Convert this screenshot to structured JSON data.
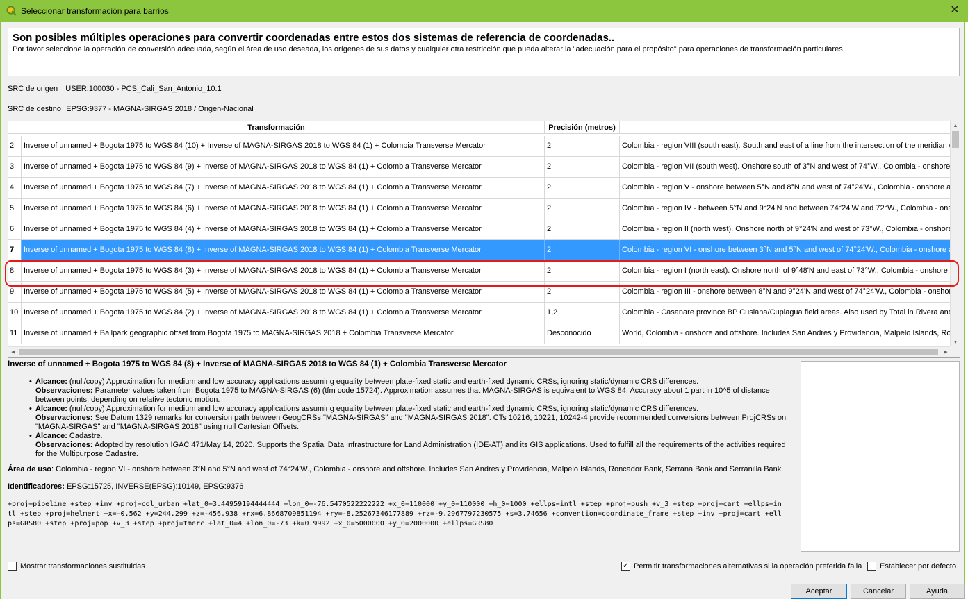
{
  "window": {
    "title": "Seleccionar transformación para barrios",
    "close_glyph": "✕"
  },
  "info": {
    "heading": "Son posibles múltiples operaciones para convertir coordenadas entre estos dos sistemas de referencia de coordenadas..",
    "subtext": "Por favor seleccione la operación de conversión adecuada, según el área de uso deseada, los orígenes de sus datos y cualquier otra restricción que pueda alterar la \"adecuación para el propósito\" para operaciones de transformación particulares"
  },
  "source": {
    "label": "SRC de origen",
    "value": "USER:100030 - PCS_Cali_San_Antonio_10.1"
  },
  "dest": {
    "label": "SRC de destino",
    "value": "EPSG:9377 - MAGNA-SIRGAS 2018 / Origen-Nacional"
  },
  "table": {
    "headers": {
      "transform": "Transformación",
      "precision": "Precisión (metros)",
      "area": ""
    },
    "rows": [
      {
        "num": "2",
        "transform": "Inverse of unnamed + Bogota 1975 to WGS 84 (10) + Inverse of MAGNA-SIRGAS 2018 to WGS 84 (1) + Colombia Transverse Mercator",
        "precision": "2",
        "area": "Colombia - region VIII (south east). South and east of a line from the intersection of the meridian of"
      },
      {
        "num": "3",
        "transform": "Inverse of unnamed + Bogota 1975 to WGS 84 (9) + Inverse of MAGNA-SIRGAS 2018 to WGS 84 (1) + Colombia Transverse Mercator",
        "precision": "2",
        "area": "Colombia - region VII (south west). Onshore south of 3°N and west of 74°W., Colombia - onshore an"
      },
      {
        "num": "4",
        "transform": "Inverse of unnamed + Bogota 1975 to WGS 84 (7) + Inverse of MAGNA-SIRGAS 2018 to WGS 84 (1) + Colombia Transverse Mercator",
        "precision": "2",
        "area": "Colombia - region V - onshore between 5°N and 8°N and west of 74°24'W., Colombia - onshore and o"
      },
      {
        "num": "5",
        "transform": "Inverse of unnamed + Bogota 1975 to WGS 84 (6) + Inverse of MAGNA-SIRGAS 2018 to WGS 84 (1) + Colombia Transverse Mercator",
        "precision": "2",
        "area": "Colombia - region IV - between 5°N and 9°24'N and between 74°24'W and 72°W., Colombia - onsho"
      },
      {
        "num": "6",
        "transform": "Inverse of unnamed + Bogota 1975 to WGS 84 (4) + Inverse of MAGNA-SIRGAS 2018 to WGS 84 (1) + Colombia Transverse Mercator",
        "precision": "2",
        "area": "Colombia - region II (north west). Onshore north of 9°24'N and west of 73°W., Colombia - onshore a"
      },
      {
        "num": "7",
        "transform": "Inverse of unnamed + Bogota 1975 to WGS 84 (8) + Inverse of MAGNA-SIRGAS 2018 to WGS 84 (1) + Colombia Transverse Mercator",
        "precision": "2",
        "area": "Colombia - region VI - onshore between 3°N and 5°N and west of 74°24'W., Colombia - onshore and o",
        "selected": true
      },
      {
        "num": "8",
        "transform": "Inverse of unnamed + Bogota 1975 to WGS 84 (3) + Inverse of MAGNA-SIRGAS 2018 to WGS 84 (1) + Colombia Transverse Mercator",
        "precision": "2",
        "area": "Colombia - region I (north east). Onshore north of 9°48'N and east of 73°W., Colombia - onshore an"
      },
      {
        "num": "9",
        "transform": "Inverse of unnamed + Bogota 1975 to WGS 84 (5) + Inverse of MAGNA-SIRGAS 2018 to WGS 84 (1) + Colombia Transverse Mercator",
        "precision": "2",
        "area": "Colombia - region III - onshore between 8°N and 9°24'N and west of 74°24'W., Colombia - onshore a"
      },
      {
        "num": "10",
        "transform": "Inverse of unnamed + Bogota 1975 to WGS 84 (2) + Inverse of MAGNA-SIRGAS 2018 to WGS 84 (1) + Colombia Transverse Mercator",
        "precision": "1,2",
        "area": "Colombia - Casanare province BP Cusiana/Cupiagua field areas. Also used by Total in Rivera and G"
      },
      {
        "num": "11",
        "transform": "Inverse of unnamed + Ballpark geographic offset from Bogota 1975 to MAGNA-SIRGAS 2018 + Colombia Transverse Mercator",
        "precision": "Desconocido",
        "area": "World, Colombia - onshore and offshore. Includes San Andres y Providencia, Malpelo Islands, Ronc"
      }
    ]
  },
  "details": {
    "title": "Inverse of unnamed + Bogota 1975 to WGS 84 (8) + Inverse of MAGNA-SIRGAS 2018 to WGS 84 (1) + Colombia Transverse Mercator",
    "alcance_label": "Alcance:",
    "obs_label": "Observaciones:",
    "items": [
      {
        "alcance": "(null/copy) Approximation for medium and low accuracy applications assuming equality between plate-fixed static and earth-fixed dynamic CRSs, ignoring static/dynamic CRS differences.",
        "obs": "Parameter values taken from Bogota 1975 to MAGNA-SIRGAS (6) (tfm code 15724). Approximation assumes that MAGNA-SIRGAS is equivalent to WGS 84. Accuracy about 1 part in 10^5 of distance between points, depending on relative tectonic motion."
      },
      {
        "alcance": "(null/copy) Approximation for medium and low accuracy applications assuming equality between plate-fixed static and earth-fixed dynamic CRSs, ignoring static/dynamic CRS differences.",
        "obs": "See Datum 1329 remarks for conversion path between GeogCRSs \"MAGNA-SIRGAS\" and \"MAGNA-SIRGAS 2018\". CTs 10216, 10221, 10242-4 provide recommended conversions between ProjCRSs on \"MAGNA-SIRGAS\" and \"MAGNA-SIRGAS 2018\" using null Cartesian Offsets."
      },
      {
        "alcance": "Cadastre.",
        "obs": "Adopted by resolution IGAC 471/May 14, 2020. Supports the Spatial Data Infrastructure for Land Administration (IDE-AT) and its GIS applications. Used to fulfill all the requirements of the activities required for the Multipurpose Cadastre."
      }
    ],
    "area_label": "Área de uso",
    "area_value": ": Colombia - region VI - onshore between 3°N and 5°N and west of 74°24'W., Colombia - onshore and offshore. Includes San Andres y Providencia, Malpelo Islands, Roncador Bank, Serrana Bank and Serranilla Bank.",
    "ids_label": "Identificadores:",
    "ids_value": " EPSG:15725, INVERSE(EPSG):10149, EPSG:9376",
    "proj": "+proj=pipeline +step +inv +proj=col_urban +lat_0=3.44959194444444 +lon_0=-76.5470522222222 +x_0=110000 +y_0=110000 +h_0=1000 +ellps=intl +step +proj=push +v_3 +step +proj=cart +ellps=intl +step +proj=helmert +x=-0.562 +y=244.299 +z=-456.938 +rx=6.8668709851194 +ry=-8.25267346177889 +rz=-9.2967797230575 +s=3.74656 +convention=coordinate_frame +step +inv +proj=cart +ellps=GRS80 +step +proj=pop +v_3 +step +proj=tmerc +lat_0=4 +lon_0=-73 +k=0.9992 +x_0=5000000 +y_0=2000000 +ellps=GRS80"
  },
  "options": {
    "show_superseded": {
      "label": "Mostrar transformaciones sustituidas",
      "checked": false
    },
    "allow_fallback": {
      "label": "Permitir transformaciones alternativas si la operación preferida falla",
      "checked": true
    },
    "set_default": {
      "label": "Establecer por defecto",
      "checked": false
    }
  },
  "buttons": {
    "accept": "Aceptar",
    "cancel": "Cancelar",
    "help": "Ayuda"
  }
}
